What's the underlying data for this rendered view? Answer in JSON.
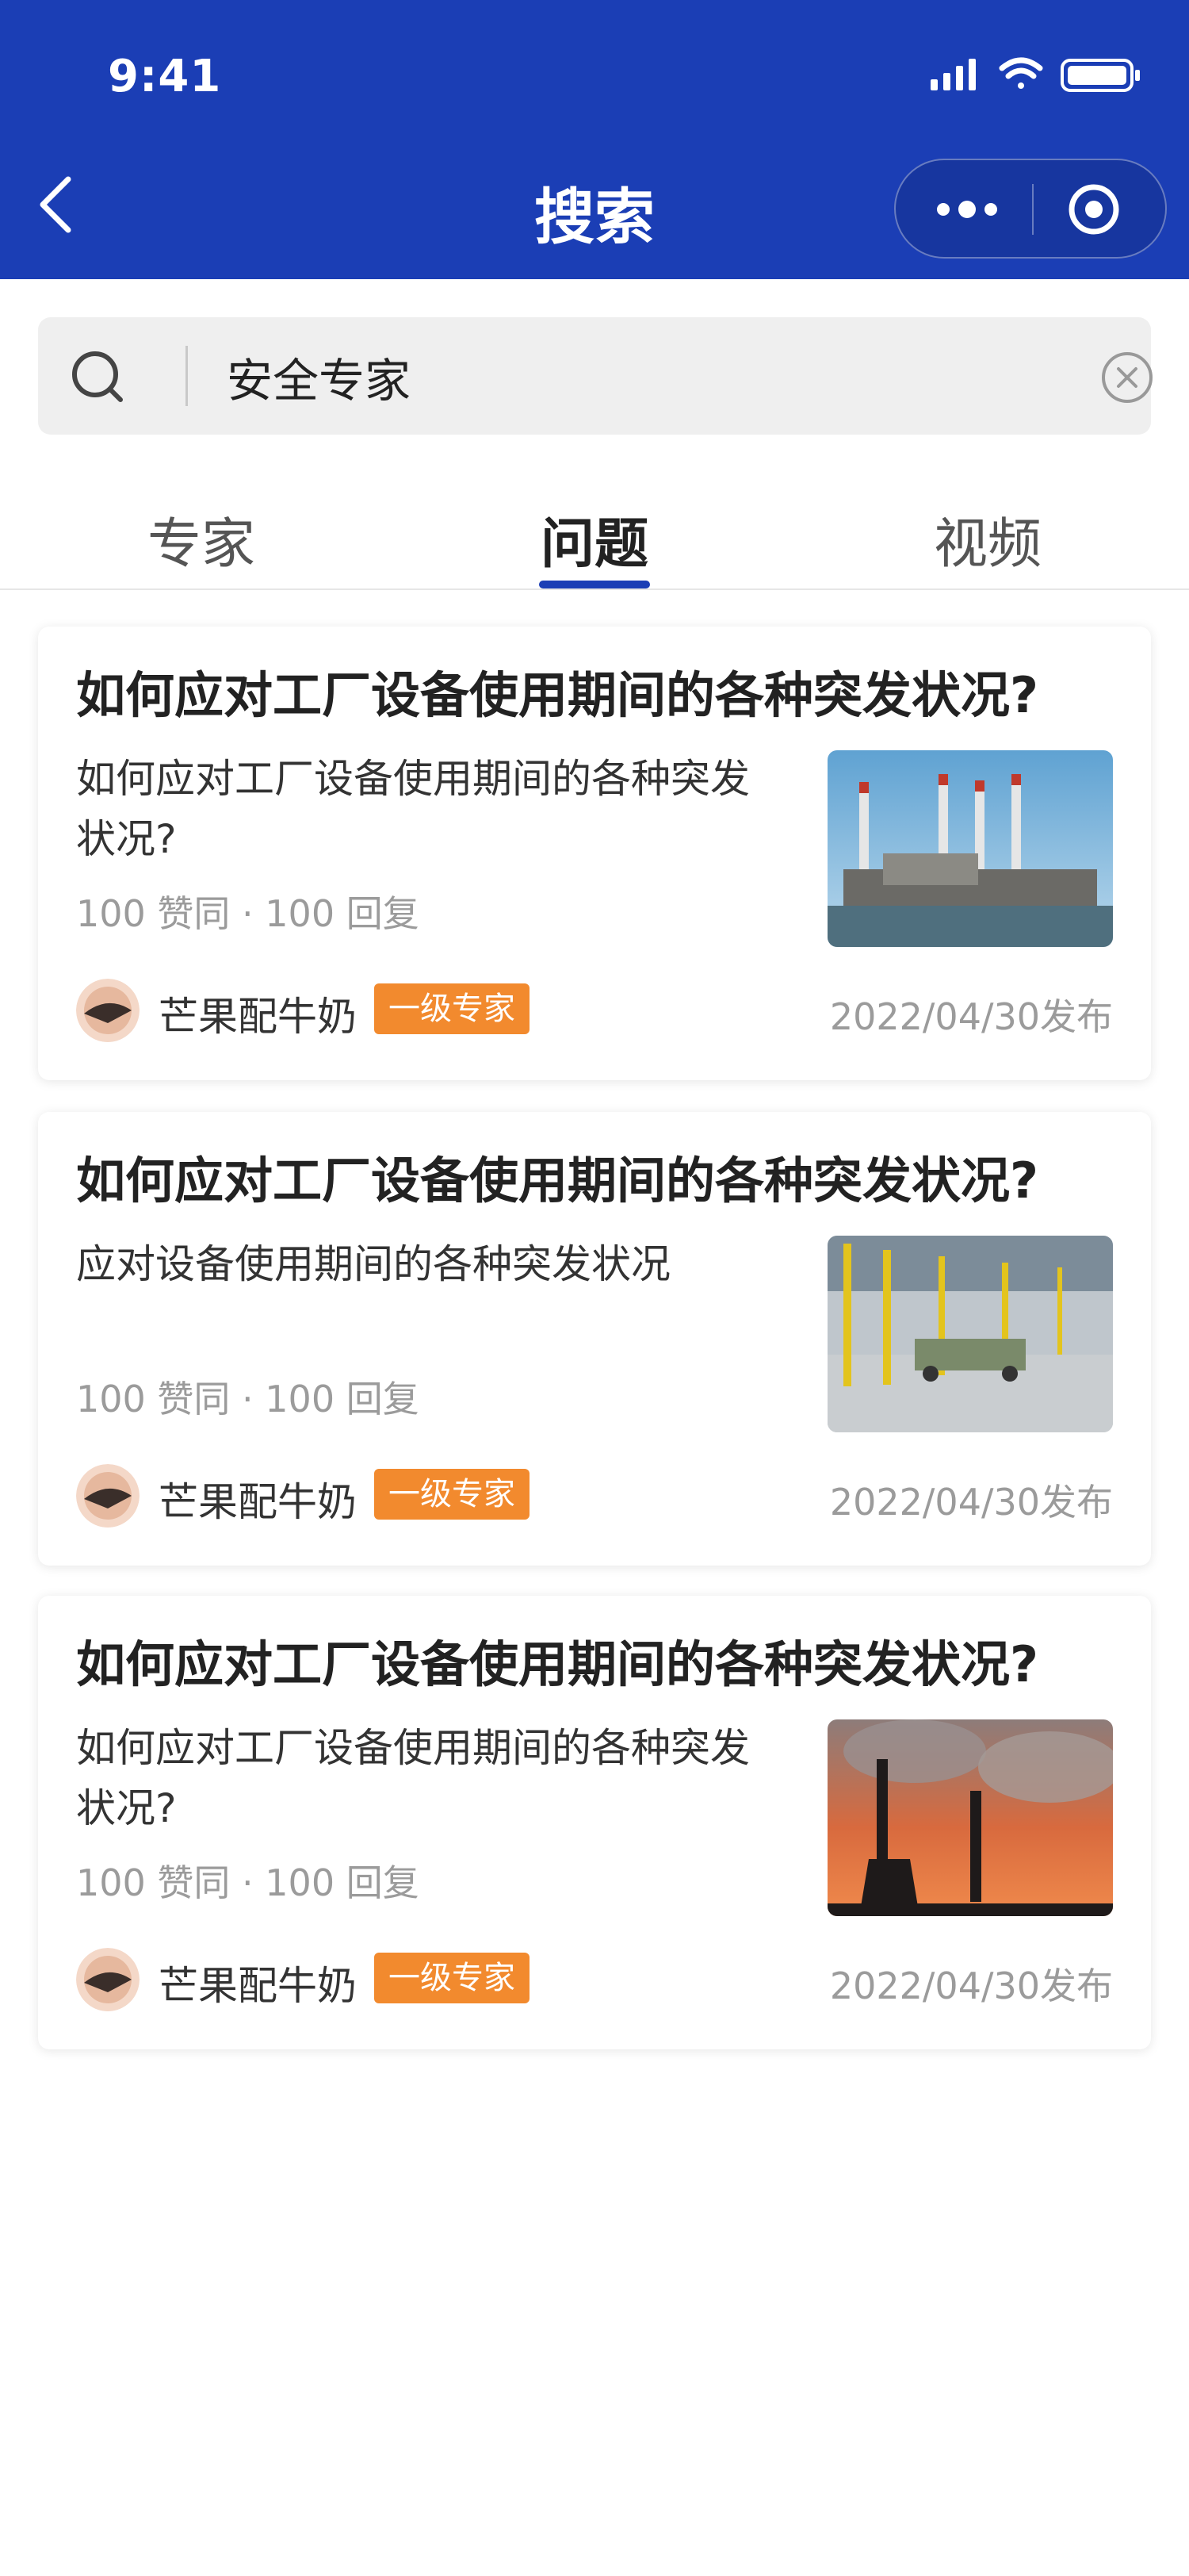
{
  "status_bar": {
    "time": "9:41"
  },
  "nav": {
    "title": "搜索"
  },
  "search": {
    "query": "安全专家"
  },
  "tabs": [
    {
      "label": "专家",
      "active": false
    },
    {
      "label": "问题",
      "active": true
    },
    {
      "label": "视频",
      "active": false
    }
  ],
  "cards": [
    {
      "title": "如何应对工厂设备使用期间的各种突发状况?",
      "description": "如何应对工厂设备使用期间的各种突发状况?",
      "stats": "100 赞同 · 100 回复",
      "author": "芒果配牛奶",
      "badge": "一级专家",
      "date": "2022/04/30发布",
      "image": "power-plant-photo"
    },
    {
      "title": "如何应对工厂设备使用期间的各种突发状况?",
      "description": "应对设备使用期间的各种突发状况",
      "stats": "100 赞同 · 100 回复",
      "author": "芒果配牛奶",
      "badge": "一级专家",
      "date": "2022/04/30发布",
      "image": "factory-hall-photo"
    },
    {
      "title": "如何应对工厂设备使用期间的各种突发状况?",
      "description": "如何应对工厂设备使用期间的各种突发状况?",
      "stats": "100 赞同 · 100 回复",
      "author": "芒果配牛奶",
      "badge": "一级专家",
      "date": "2022/04/30发布",
      "image": "smokestack-sunset-photo"
    }
  ],
  "colors": {
    "header": "#1B3EB5",
    "accent": "#1B3EB5",
    "badge": "#F28A2E"
  }
}
